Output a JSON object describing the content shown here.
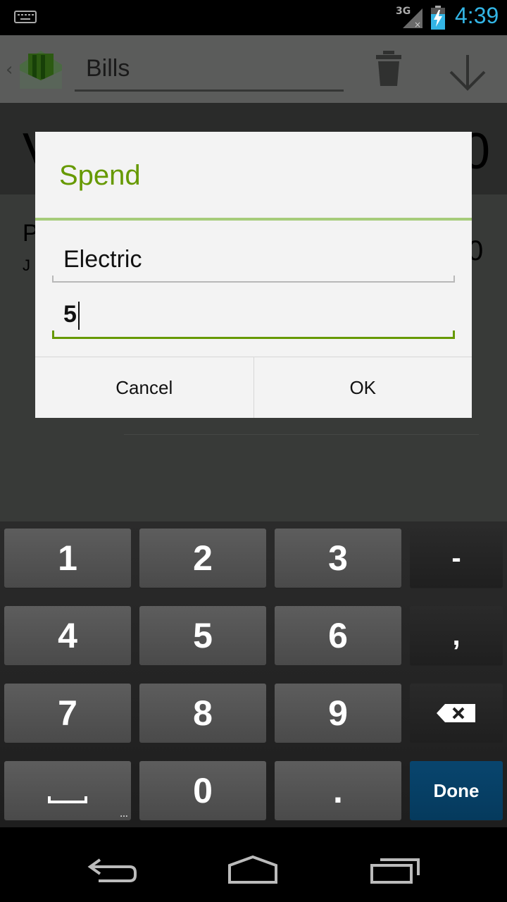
{
  "status_bar": {
    "network": "3G",
    "time": "4:39",
    "icons": [
      "keyboard-icon",
      "signal-icon",
      "battery-charging-icon"
    ]
  },
  "action_bar": {
    "title": "Bills",
    "icons": [
      "app-logo-icon",
      "trash-icon",
      "arrow-down-icon"
    ]
  },
  "dialog": {
    "title": "Spend",
    "name_value": "Electric",
    "amount_value": "5",
    "cancel_label": "Cancel",
    "ok_label": "OK"
  },
  "keyboard": {
    "keys": {
      "k1": "1",
      "k2": "2",
      "k3": "3",
      "minus": "-",
      "k4": "4",
      "k5": "5",
      "k6": "6",
      "comma": ",",
      "k7": "7",
      "k8": "8",
      "k9": "9",
      "k0": "0",
      "period": ".",
      "done": "Done"
    },
    "icons": [
      "space-icon",
      "backspace-icon"
    ]
  },
  "nav_bar": {
    "icons": [
      "back-icon",
      "home-icon",
      "recent-apps-icon"
    ]
  },
  "colors": {
    "accent_green": "#669900",
    "clock_blue": "#33b5e5",
    "done_key": "#08456e"
  }
}
